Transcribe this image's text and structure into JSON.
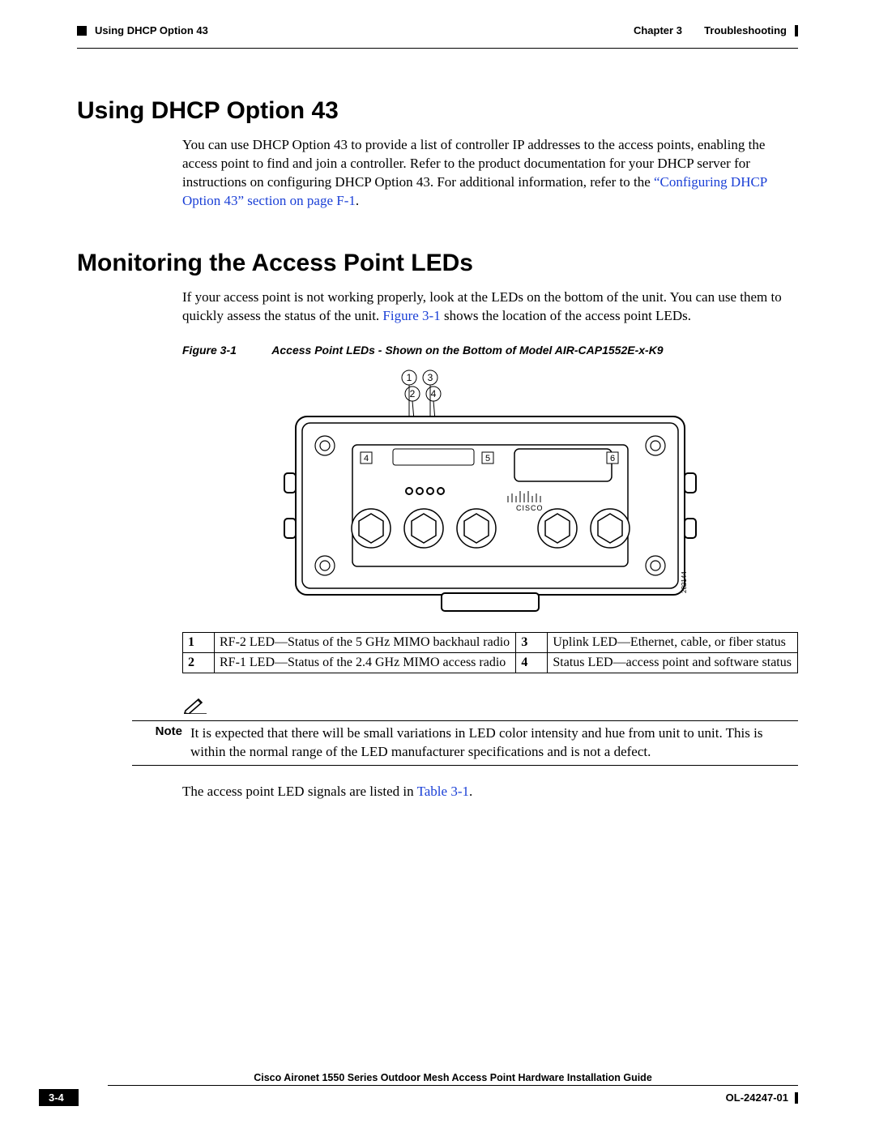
{
  "header": {
    "left": "Using DHCP Option 43",
    "right_chapter": "Chapter 3",
    "right_title": "Troubleshooting"
  },
  "section1": {
    "title": "Using DHCP Option 43",
    "para_a": "You can use DHCP Option 43 to provide a list of controller IP addresses to the access points, enabling the access point to find and join a controller. Refer to the product documentation for your DHCP server for instructions on configuring DHCP Option 43. For additional information, refer to the ",
    "link": "“Configuring DHCP Option 43” section on page F-1",
    "para_b": "."
  },
  "section2": {
    "title": "Monitoring the Access Point LEDs",
    "para_a": "If your access point is not working properly, look at the LEDs on the bottom of the unit. You can use them to quickly assess the status of the unit. ",
    "link": "Figure 3-1",
    "para_b": " shows the location of the access point LEDs."
  },
  "figure": {
    "label": "Figure 3-1",
    "caption": "Access Point LEDs - Shown on the Bottom of Model AIR-CAP1552E-x-K9",
    "callouts": {
      "c1": "1",
      "c2": "2",
      "c3": "3",
      "c4": "4"
    },
    "panel": {
      "p4": "4",
      "p5": "5",
      "p6": "6"
    },
    "id": "282144"
  },
  "legend": {
    "rows": [
      {
        "n1": "1",
        "t1": "RF-2 LED—Status of the 5 GHz MIMO backhaul radio",
        "n2": "3",
        "t2": "Uplink LED—Ethernet, cable, or fiber status"
      },
      {
        "n1": "2",
        "t1": "RF-1 LED—Status of the 2.4 GHz MIMO access radio",
        "n2": "4",
        "t2": "Status LED—access point and software status"
      }
    ]
  },
  "note": {
    "label": "Note",
    "text": "It is expected that there will be small variations in LED color intensity and hue from unit to unit. This is within the normal range of the LED manufacturer specifications and is not a defect."
  },
  "after_note": {
    "pre": "The access point LED signals are listed in ",
    "link": "Table 3-1",
    "post": "."
  },
  "footer": {
    "title": "Cisco Aironet 1550 Series Outdoor Mesh Access Point Hardware Installation Guide",
    "page": "3-4",
    "docid": "OL-24247-01"
  }
}
